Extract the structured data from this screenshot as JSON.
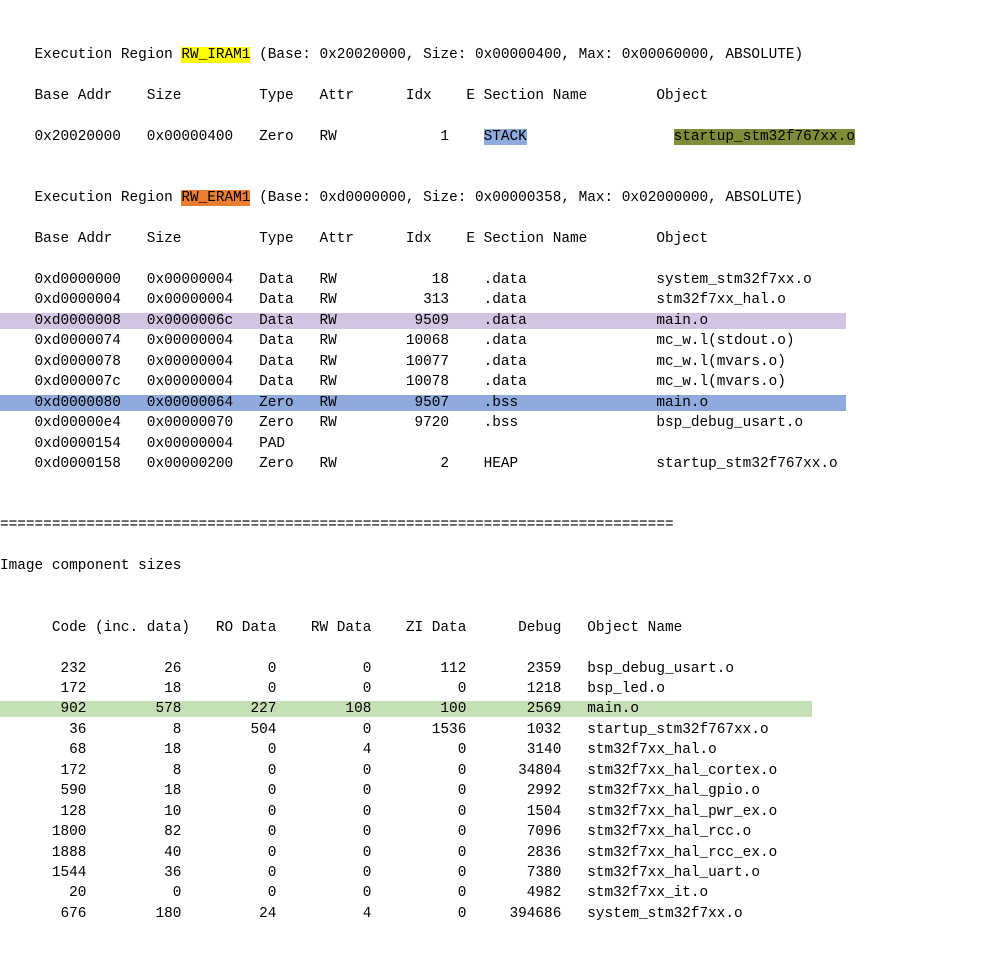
{
  "region1": {
    "prefix": "    Execution Region ",
    "name": "RW_IRAM1",
    "suffix": " (Base: 0x20020000, Size: 0x00000400, Max: 0x00060000, ABSOLUTE)",
    "header": "    Base Addr    Size         Type   Attr      Idx    E Section Name        Object",
    "row_pre": "    0x20020000   0x00000400   Zero   RW            1    ",
    "stack": "STACK",
    "row_mid": "                 ",
    "obj": "startup_stm32f767xx.o"
  },
  "region2": {
    "prefix": "    Execution Region ",
    "name": "RW_ERAM1",
    "suffix": " (Base: 0xd0000000, Size: 0x00000358, Max: 0x02000000, ABSOLUTE)",
    "header": "    Base Addr    Size         Type   Attr      Idx    E Section Name        Object",
    "r0": "    0xd0000000   0x00000004   Data   RW           18    .data               system_stm32f7xx.o",
    "r1": "    0xd0000004   0x00000004   Data   RW          313    .data               stm32f7xx_hal.o",
    "r2": "    0xd0000008   0x0000006c   Data   RW         9509    .data               main.o",
    "r2pad": "                ",
    "r3": "    0xd0000074   0x00000004   Data   RW        10068    .data               mc_w.l(stdout.o)",
    "r4": "    0xd0000078   0x00000004   Data   RW        10077    .data               mc_w.l(mvars.o)",
    "r5": "    0xd000007c   0x00000004   Data   RW        10078    .data               mc_w.l(mvars.o)",
    "r6": "    0xd0000080   0x00000064   Zero   RW         9507    .bss                main.o",
    "r6pad": "                ",
    "r7": "    0xd00000e4   0x00000070   Zero   RW         9720    .bss                bsp_debug_usart.o",
    "r8": "    0xd0000154   0x00000004   PAD",
    "r9": "    0xd0000158   0x00000200   Zero   RW            2    HEAP                startup_stm32f767xx.o"
  },
  "divider": "==============================================================================",
  "ics_title": "Image component sizes",
  "ics_header": "      Code (inc. data)   RO Data    RW Data    ZI Data      Debug   Object Name",
  "ics": {
    "r0": "       232         26          0          0        112       2359   bsp_debug_usart.o",
    "r1": "       172         18          0          0          0       1218   bsp_led.o",
    "r2": "       902        578        227        108        100       2569   main.o",
    "r2pad": "                    ",
    "r3": "        36          8        504          0       1536       1032   startup_stm32f767xx.o",
    "r4": "        68         18          0          4          0       3140   stm32f7xx_hal.o",
    "r5": "       172          8          0          0          0      34804   stm32f7xx_hal_cortex.o",
    "r6": "       590         18          0          0          0       2992   stm32f7xx_hal_gpio.o",
    "r7": "       128         10          0          0          0       1504   stm32f7xx_hal_pwr_ex.o",
    "r8": "      1800         82          0          0          0       7096   stm32f7xx_hal_rcc.o",
    "r9": "      1888         40          0          0          0       2836   stm32f7xx_hal_rcc_ex.o",
    "r10": "      1544         36          0          0          0       7380   stm32f7xx_hal_uart.o",
    "r11": "        20          0          0          0          0       4982   stm32f7xx_it.o",
    "r12": "       676        180         24          4          0     394686   system_stm32f7xx.o"
  }
}
